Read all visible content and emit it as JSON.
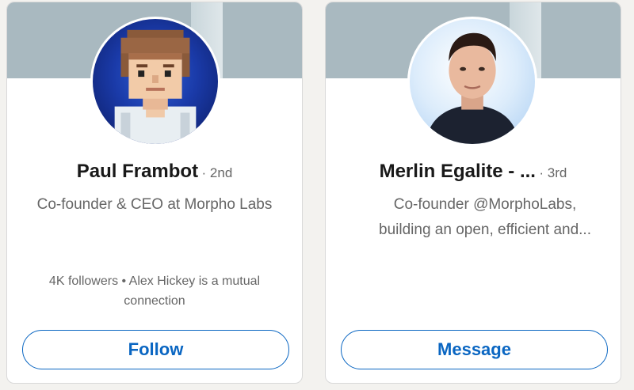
{
  "cards": [
    {
      "name": "Paul Frambot",
      "degree": "· 2nd",
      "headline": "Co-founder & CEO at Morpho Labs",
      "meta": "4K followers • Alex Hickey is a mutual connection",
      "button_label": "Follow",
      "avatar_icon": "pixel-art-avatar"
    },
    {
      "name": "Merlin Egalite - ...",
      "degree": "· 3rd",
      "headline_line1": "Co-founder @MorphoLabs,",
      "headline_line2": "building an open, efficient and...",
      "button_label": "Message",
      "avatar_icon": "profile-photo"
    }
  ],
  "colors": {
    "accent": "#0a66c2",
    "banner": "#a9b9c0",
    "name": "#191919",
    "secondary_text": "#666666"
  }
}
